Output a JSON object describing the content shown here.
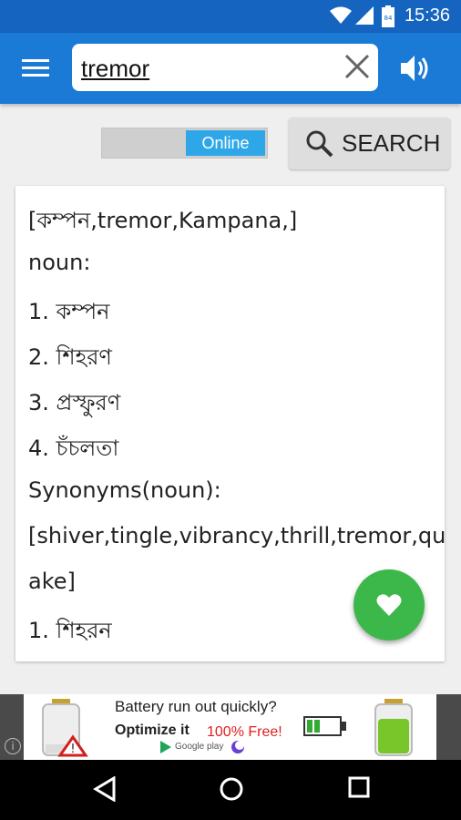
{
  "status_bar": {
    "time": "15:36",
    "battery_level": "84",
    "icons": [
      "wifi-icon",
      "signal-icon",
      "battery-icon"
    ]
  },
  "app_bar": {
    "menu_icon": "hamburger-menu-icon",
    "search": {
      "value": "tremor",
      "placeholder": ""
    },
    "clear_icon": "close-icon",
    "speak_icon": "speaker-icon"
  },
  "controls": {
    "toggle_label": "Online",
    "search_button_label": "SEARCH",
    "search_icon": "magnifier-icon"
  },
  "result": {
    "lines": [
      "[কম্পন,tremor,Kampana,]",
      "noun:",
      "1. কম্পন",
      "2. শিহরণ",
      "3. প্রস্ফুরণ",
      "4. চঁচলতা",
      "Synonyms(noun):",
      "[shiver,tingle,vibrancy,thrill,tremor,qu",
      "ake]",
      "1. শিহরন"
    ]
  },
  "fab": {
    "icon": "heart-icon"
  },
  "ad": {
    "headline": "Battery run out quickly?",
    "subline": "Optimize it",
    "highlight": "100% Free!",
    "store_label": "Google play",
    "info_icon": "i"
  },
  "nav_bar": {
    "icons": [
      "back-icon",
      "home-icon",
      "recents-icon"
    ]
  },
  "colors": {
    "status_bar": "#1565c0",
    "app_bar": "#1a7ad6",
    "toggle_on": "#2ea7e8",
    "fab": "#3cb84a",
    "ad_free": "#e02020"
  }
}
